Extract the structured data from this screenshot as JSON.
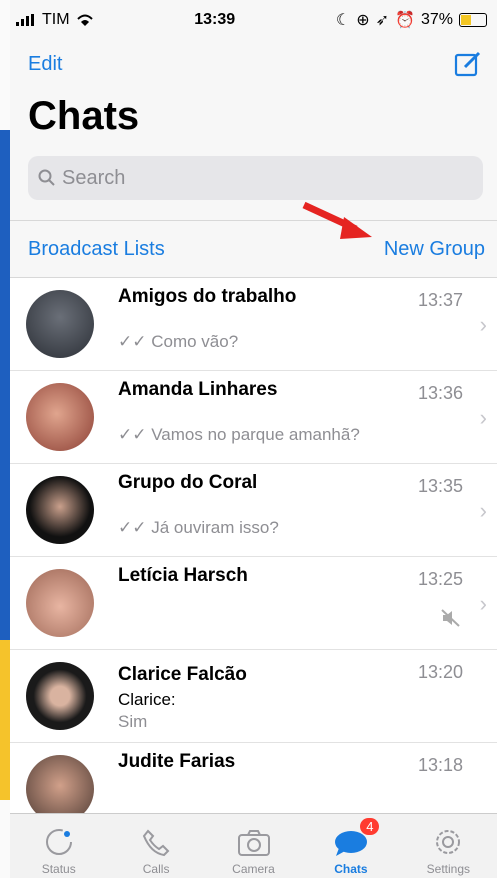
{
  "status_bar": {
    "carrier": "TIM",
    "time": "13:39",
    "battery": "37%"
  },
  "nav": {
    "edit_label": "Edit",
    "compose_icon": "compose-icon"
  },
  "title": "Chats",
  "search": {
    "placeholder": "Search"
  },
  "links": {
    "broadcast": "Broadcast Lists",
    "new_group": "New Group"
  },
  "chats": [
    {
      "name": "Amigos do trabalho",
      "time": "13:37",
      "message": "Como vão?",
      "read": true,
      "avatar_color": "#3a3f4a"
    },
    {
      "name": "Amanda Linhares",
      "time": "13:36",
      "message": "Vamos no parque amanhã?",
      "read": true,
      "avatar_color": "#b26052"
    },
    {
      "name": "Grupo do Coral",
      "time": "13:35",
      "message": "Já ouviram isso?",
      "read": true,
      "avatar_color": "#2a2a2a"
    },
    {
      "name": "Letícia Harsch",
      "time": "13:25",
      "message": "",
      "muted": true,
      "avatar_color": "#c88f7b"
    },
    {
      "name": "Clarice Falcão",
      "time": "13:20",
      "sender": "Clarice:",
      "message": "Sim",
      "avatar_color": "#1d1d1d"
    },
    {
      "name": "Judite Farias",
      "time": "13:18",
      "message": "",
      "avatar_color": "#6b4b3f"
    }
  ],
  "tabs": [
    {
      "label": "Status",
      "icon": "status-icon"
    },
    {
      "label": "Calls",
      "icon": "phone-icon"
    },
    {
      "label": "Camera",
      "icon": "camera-icon"
    },
    {
      "label": "Chats",
      "icon": "chats-icon",
      "badge": "4",
      "active": true
    },
    {
      "label": "Settings",
      "icon": "gear-icon"
    }
  ],
  "colors": {
    "accent": "#1a7de0",
    "badge": "#ff3b30",
    "arrow": "#e52421"
  }
}
